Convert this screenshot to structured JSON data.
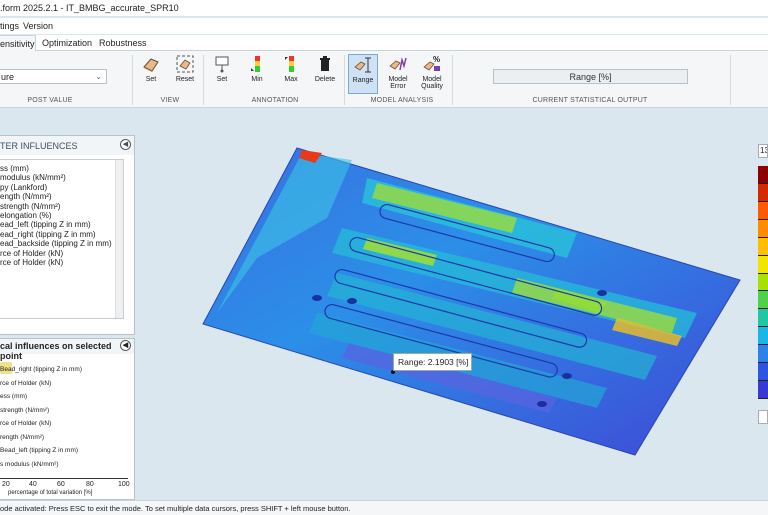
{
  "window": {
    "title": ".form 2025.2.1 - IT_BMBG_accurate_SPR10"
  },
  "menu": {
    "items": [
      "tings",
      "Version"
    ]
  },
  "tabs": [
    {
      "label": "ensitivity",
      "active": true
    },
    {
      "label": "Optimization",
      "active": false
    },
    {
      "label": "Robustness",
      "active": false
    }
  ],
  "ribbon": {
    "post_value": {
      "selected": "ure",
      "group_label": "POST VALUE"
    },
    "view": {
      "set": "Set",
      "reset": "Reset",
      "group_label": "VIEW"
    },
    "annotation": {
      "set": "Set",
      "min": "Min",
      "max": "Max",
      "delete": "Delete",
      "group_label": "ANNOTATION"
    },
    "model_analysis": {
      "range": "Range",
      "model_error_1": "Model",
      "model_error_2": "Error",
      "model_quality_1": "Model",
      "model_quality_2": "Quality",
      "group_label": "MODEL ANALYSIS"
    },
    "statistical_output": {
      "value": "Range [%]",
      "group_label": "CURRENT STATISTICAL OUTPUT"
    }
  },
  "parameter_panel": {
    "title": "TER INFLUENCES",
    "items": [
      "ss (mm)",
      "modulus (kN/mm²)",
      "py (Lankford)",
      "ength (N/mm²)",
      "strength (N/mm²)",
      "elongation (%)",
      "ead_left (tipping Z in mm)",
      "ead_right (tipping Z in mm)",
      "ead_backside (tipping Z in mm)",
      "rce of Holder (kN)",
      "rce of Holder (kN)"
    ]
  },
  "influence_panel": {
    "title": "cal influences on selected point",
    "rows": [
      "Bead_right (tipping Z in mm)",
      "rce of Holder (kN)",
      "ess (mm)",
      "strength (N/mm²)",
      "rce of Holder (kN)",
      "rength (N/mm²)",
      "Bead_left (tipping Z in mm)",
      "s modulus (kN/mm²)"
    ],
    "x_ticks": [
      "20",
      "40",
      "60",
      "80",
      "100"
    ],
    "x_label": "percentage of total variation [%]"
  },
  "viewport": {
    "tooltip": "Range: 2.1903 [%]",
    "colorbar_top": "13"
  },
  "colors": {
    "accent": "#3a6ea5",
    "colorbar": [
      "#8b0000",
      "#d42a00",
      "#ff5a00",
      "#ff8c00",
      "#ffbf00",
      "#f2e600",
      "#a8e000",
      "#4fd24a",
      "#1fc7a3",
      "#19b7e8",
      "#2a82ea",
      "#2d55e0",
      "#3a3ad0"
    ]
  },
  "status": {
    "text": "ode activated: Press ESC to exit the mode. To set multiple data cursors, press SHIFT + left mouse button."
  }
}
